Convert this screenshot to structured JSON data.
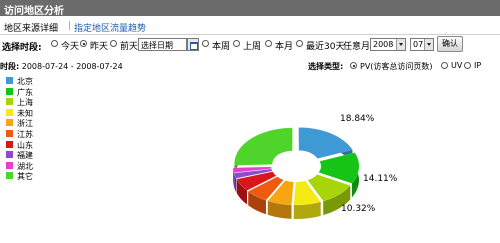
{
  "header": {
    "title": "访问地区分析"
  },
  "tabs": {
    "detail": "地区来源详细",
    "separator": "|",
    "trend": "指定地区流量趋势"
  },
  "controls": {
    "label": "选择时段:",
    "options": [
      {
        "label": "今天",
        "selected": false
      },
      {
        "label": "昨天",
        "selected": true
      },
      {
        "label": "前天",
        "selected": false
      }
    ],
    "date_placeholder": "选择日期",
    "options2": [
      {
        "label": "本周",
        "selected": false
      },
      {
        "label": "上周",
        "selected": false
      },
      {
        "label": "本月",
        "selected": false
      },
      {
        "label": "最近30天",
        "selected": false
      }
    ],
    "any_month_label": "任意月",
    "year": "2008",
    "month": "07",
    "confirm": "确认"
  },
  "period": {
    "label": "时段:",
    "range": "2008-07-24 - 2008-07-24"
  },
  "select_type": {
    "label": "选择类型:",
    "options": [
      {
        "label": "PV(访客总访问页数)",
        "selected": true
      },
      {
        "label": "UV",
        "selected": false
      },
      {
        "label": "IP",
        "selected": false
      }
    ]
  },
  "legend": [
    {
      "label": "北京",
      "color": "#3e99d4"
    },
    {
      "label": "广东",
      "color": "#16c416"
    },
    {
      "label": "上海",
      "color": "#a8d40a"
    },
    {
      "label": "未知",
      "color": "#f5ea12"
    },
    {
      "label": "浙江",
      "color": "#f7a612"
    },
    {
      "label": "江苏",
      "color": "#ee5b10"
    },
    {
      "label": "山东",
      "color": "#d8161b"
    },
    {
      "label": "福建",
      "color": "#8a4bd0"
    },
    {
      "label": "湖北",
      "color": "#e63fcc"
    },
    {
      "label": "其它",
      "color": "#4fd42c"
    }
  ],
  "chart_data": {
    "type": "pie",
    "style": "3d-donut",
    "categories": [
      "北京",
      "广东",
      "上海",
      "未知",
      "浙江",
      "江苏",
      "山东",
      "福建",
      "湖北",
      "其它"
    ],
    "values": [
      18.84,
      14.11,
      10.32,
      7.6,
      6.8,
      6.3,
      5.8,
      2.4,
      2.2,
      25.63
    ],
    "data_labels": [
      "18.84%",
      "14.11%",
      "10.32%"
    ]
  }
}
